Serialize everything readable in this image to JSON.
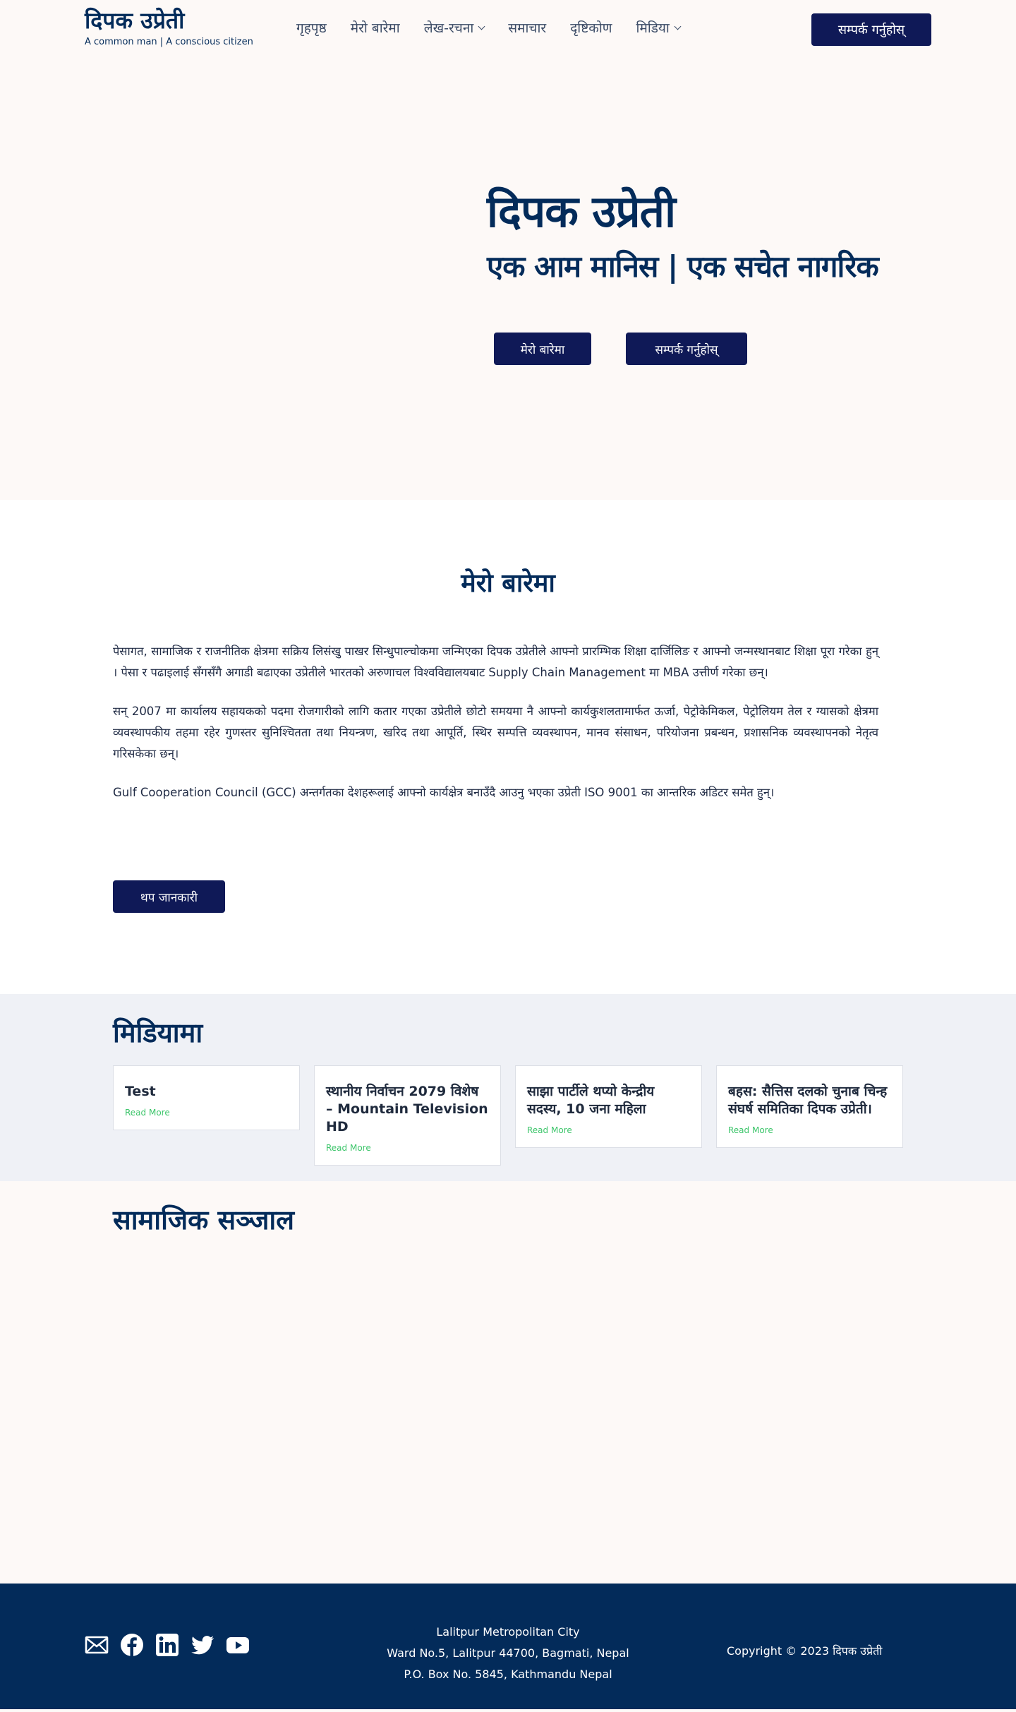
{
  "header": {
    "site_title": "दिपक उप्रेती",
    "tagline": "A common man | A conscious citizen",
    "nav": [
      {
        "label": "गृहपृष्ठ",
        "has_dropdown": false
      },
      {
        "label": "मेरो बारेमा",
        "has_dropdown": false
      },
      {
        "label": "लेख-रचना",
        "has_dropdown": true
      },
      {
        "label": "समाचार",
        "has_dropdown": false
      },
      {
        "label": "दृष्टिकोण",
        "has_dropdown": false
      },
      {
        "label": "मिडिया",
        "has_dropdown": true
      }
    ],
    "cta_label": "सम्पर्क गर्नुहोस्"
  },
  "hero": {
    "title": "दिपक उप्रेती",
    "subtitle": "एक आम मानिस | एक सचेत नागरिक",
    "about_button": "मेरो बारेमा",
    "contact_button": "सम्पर्क गर्नुहोस्"
  },
  "about": {
    "heading": "मेरो बारेमा",
    "paragraphs": [
      "पेसागत, सामाजिक र राजनीतिक क्षेत्रमा सक्रिय लिसंखु पाखर सिन्धुपाल्चोकमा जन्मिएका दिपक उप्रेतीले आफ्नो प्रारम्भिक शिक्षा दार्जिलिङ र आफ्नो जन्मस्थानबाट शिक्षा पूरा गरेका हुन् । पेसा र पढाइलाई सँगसँगै अगाडी बढाएका उप्रेतीले भारतको अरुणाचल विश्वविद्यालयबाट Supply Chain Management मा MBA उत्तीर्ण गरेका छन्।",
      "सन् 2007 मा कार्यालय सहायकको पदमा रोजगारीको लागि कतार गएका उप्रेतीले छोटो समयमा नै आफ्नो कार्यकुशलतामार्फत ऊर्जा, पेट्रोकेमिकल, पेट्रोलियम तेल र ग्यासको क्षेत्रमा व्यवस्थापकीय तहमा रहेर गुणस्तर सुनिश्चितता तथा नियन्त्रण, खरिद तथा आपूर्ति, स्थिर सम्पत्ति व्यवस्थापन, मानव संसाधन, परियोजना प्रबन्धन, प्रशासनिक व्यवस्थापनको नेतृत्व गरिसकेका छन्।",
      "Gulf Cooperation Council (GCC) अन्तर्गतका देशहरूलाई आफ्नो कार्यक्षेत्र बनाउँदै आउनु भएका उप्रेती ISO 9001 का आन्तरिक अडिटर समेत हुन्।"
    ],
    "more_button": "थप जानकारी"
  },
  "media": {
    "heading": "मिडियामा",
    "cards": [
      {
        "title": "Test",
        "link": "Read More"
      },
      {
        "title": "स्थानीय निर्वाचन 2079 विशेष – Mountain Television HD",
        "link": "Read More"
      },
      {
        "title": "साझा पार्टीले थप्यो केन्द्रीय सदस्य, 10 जना महिला",
        "link": "Read More"
      },
      {
        "title": "बहस: सैत्तिस दलको चुनाब चिन्ह संघर्ष समितिका दिपक उप्रेती।",
        "link": "Read More"
      }
    ]
  },
  "social": {
    "heading": "सामाजिक सञ्जाल"
  },
  "footer": {
    "icons": [
      "mail-icon",
      "facebook-icon",
      "linkedin-icon",
      "twitter-icon",
      "youtube-icon"
    ],
    "address": [
      "Lalitpur Metropolitan City",
      "Ward No.5, Lalitpur 44700, Bagmati, Nepal",
      "P.O. Box No. 5845, Kathmandu Nepal"
    ],
    "copyright": "Copyright © 2023 दिपक उप्रेती"
  },
  "colors": {
    "navy": "#032b5a",
    "button": "#0f1957",
    "link_green": "#3cc56a",
    "cream_bg": "#fdf9f7",
    "media_bg": "#eff1f6"
  }
}
